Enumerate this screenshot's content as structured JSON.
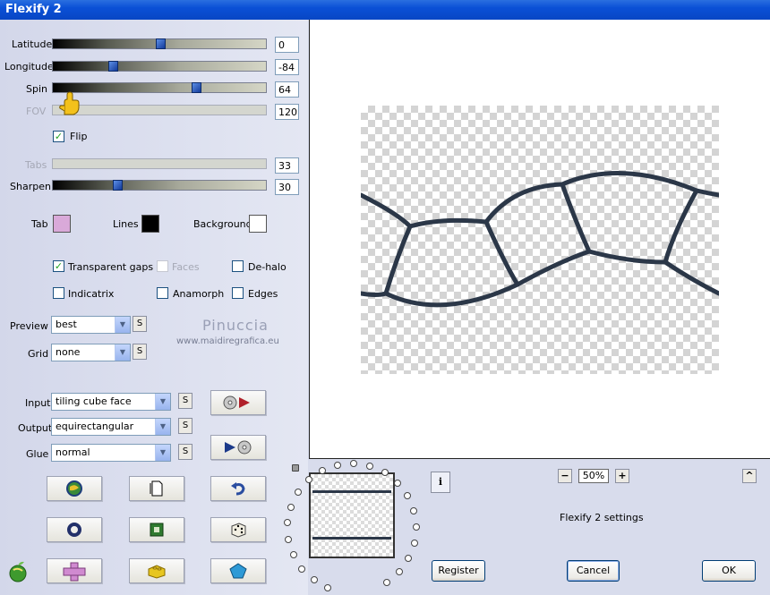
{
  "window": {
    "title": "Flexify 2"
  },
  "sliders": [
    {
      "label": "Latitude",
      "value": "0",
      "level": 0.5,
      "enabled": true
    },
    {
      "label": "Longitude",
      "value": "-84",
      "level": 0.28,
      "enabled": true
    },
    {
      "label": "Spin",
      "value": "64",
      "level": 0.67,
      "enabled": true
    },
    {
      "label": "FOV",
      "value": "120",
      "level": 0.08,
      "enabled": false
    },
    {
      "label": "Tabs",
      "value": "33",
      "level": 0.0,
      "enabled": false
    },
    {
      "label": "Sharpen",
      "value": "30",
      "level": 0.3,
      "enabled": true
    }
  ],
  "flip": {
    "label": "Flip",
    "checked": true
  },
  "colors": {
    "tab_label": "Tab",
    "tab_color": "#d9a9d9",
    "lines_label": "Lines",
    "lines_color": "#000000",
    "background_label": "Background",
    "background_color": "#ffffff"
  },
  "options": [
    {
      "label": "Transparent gaps",
      "checked": true,
      "enabled": true
    },
    {
      "label": "Faces",
      "checked": false,
      "enabled": false
    },
    {
      "label": "De-halo",
      "checked": false,
      "enabled": true
    },
    {
      "label": "Indicatrix",
      "checked": false,
      "enabled": true
    },
    {
      "label": "Anamorph",
      "checked": false,
      "enabled": true
    },
    {
      "label": "Edges",
      "checked": false,
      "enabled": true
    }
  ],
  "preview": {
    "label": "Preview",
    "value": "best"
  },
  "grid": {
    "label": "Grid",
    "value": "none"
  },
  "input": {
    "label": "Input",
    "value": "tiling cube face"
  },
  "output": {
    "label": "Output",
    "value": "equirectangular"
  },
  "glue": {
    "label": "Glue",
    "value": "normal"
  },
  "s_button": "S",
  "watermark": {
    "name": "Pinuccia",
    "url": "www.maidiregrafica.eu"
  },
  "zoom": {
    "value": "50%",
    "minus": "−",
    "plus": "+"
  },
  "info_button": "i",
  "up_button": "^",
  "settings_label": "Flexify 2 settings",
  "buttons": {
    "register": "Register",
    "cancel": "Cancel",
    "ok": "OK"
  },
  "icons": {
    "forward": "cd-forward-icon",
    "backward": "cd-backward-icon",
    "globe": "globe-icon",
    "page": "page-icon",
    "undo": "undo-icon",
    "ring": "ring-icon",
    "square": "square-icon",
    "dice": "dice-icon",
    "plus_shape": "cross-shape-icon",
    "lego": "block-icon",
    "pentagon": "pentagon-icon",
    "apple": "apple-logo-icon"
  }
}
